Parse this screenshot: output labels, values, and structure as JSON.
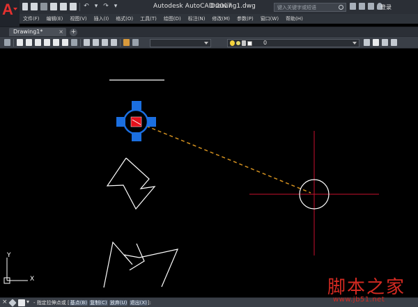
{
  "app": {
    "title": "Autodesk AutoCAD 2017",
    "document_title": "Drawing1.dwg",
    "logo_letter": "A"
  },
  "search": {
    "placeholder": "键入关键字或短语"
  },
  "login_label": "登录",
  "menu": [
    "文件(F)",
    "编辑(E)",
    "视图(V)",
    "插入(I)",
    "格式(O)",
    "工具(T)",
    "绘图(D)",
    "标注(N)",
    "修改(M)",
    "参数(P)",
    "窗口(W)",
    "帮助(H)"
  ],
  "tabs": {
    "active_label": "Drawing1*",
    "close_glyph": "×",
    "new_glyph": "+"
  },
  "layer": {
    "current": "0"
  },
  "command_line": {
    "close_glyph": "×",
    "dropdown_glyph": "▾",
    "prompt": "- 指定拉伸点或 [",
    "options": [
      "基点(B)",
      "复制(C)",
      "放弃(U)",
      "退出(X)"
    ],
    "suffix": "]:"
  },
  "ucs": {
    "x_label": "X",
    "y_label": "Y"
  },
  "colors": {
    "background": "#000000",
    "geometry": "#ffffff",
    "grip": "#1b6fe0",
    "hot_grip": "#e3111b",
    "rubber_band": "#d4911f",
    "crosshair": "#c8102e",
    "logo": "#e3312f"
  },
  "watermark": {
    "chars": "脚本之家",
    "url": "www.jb51.net"
  }
}
